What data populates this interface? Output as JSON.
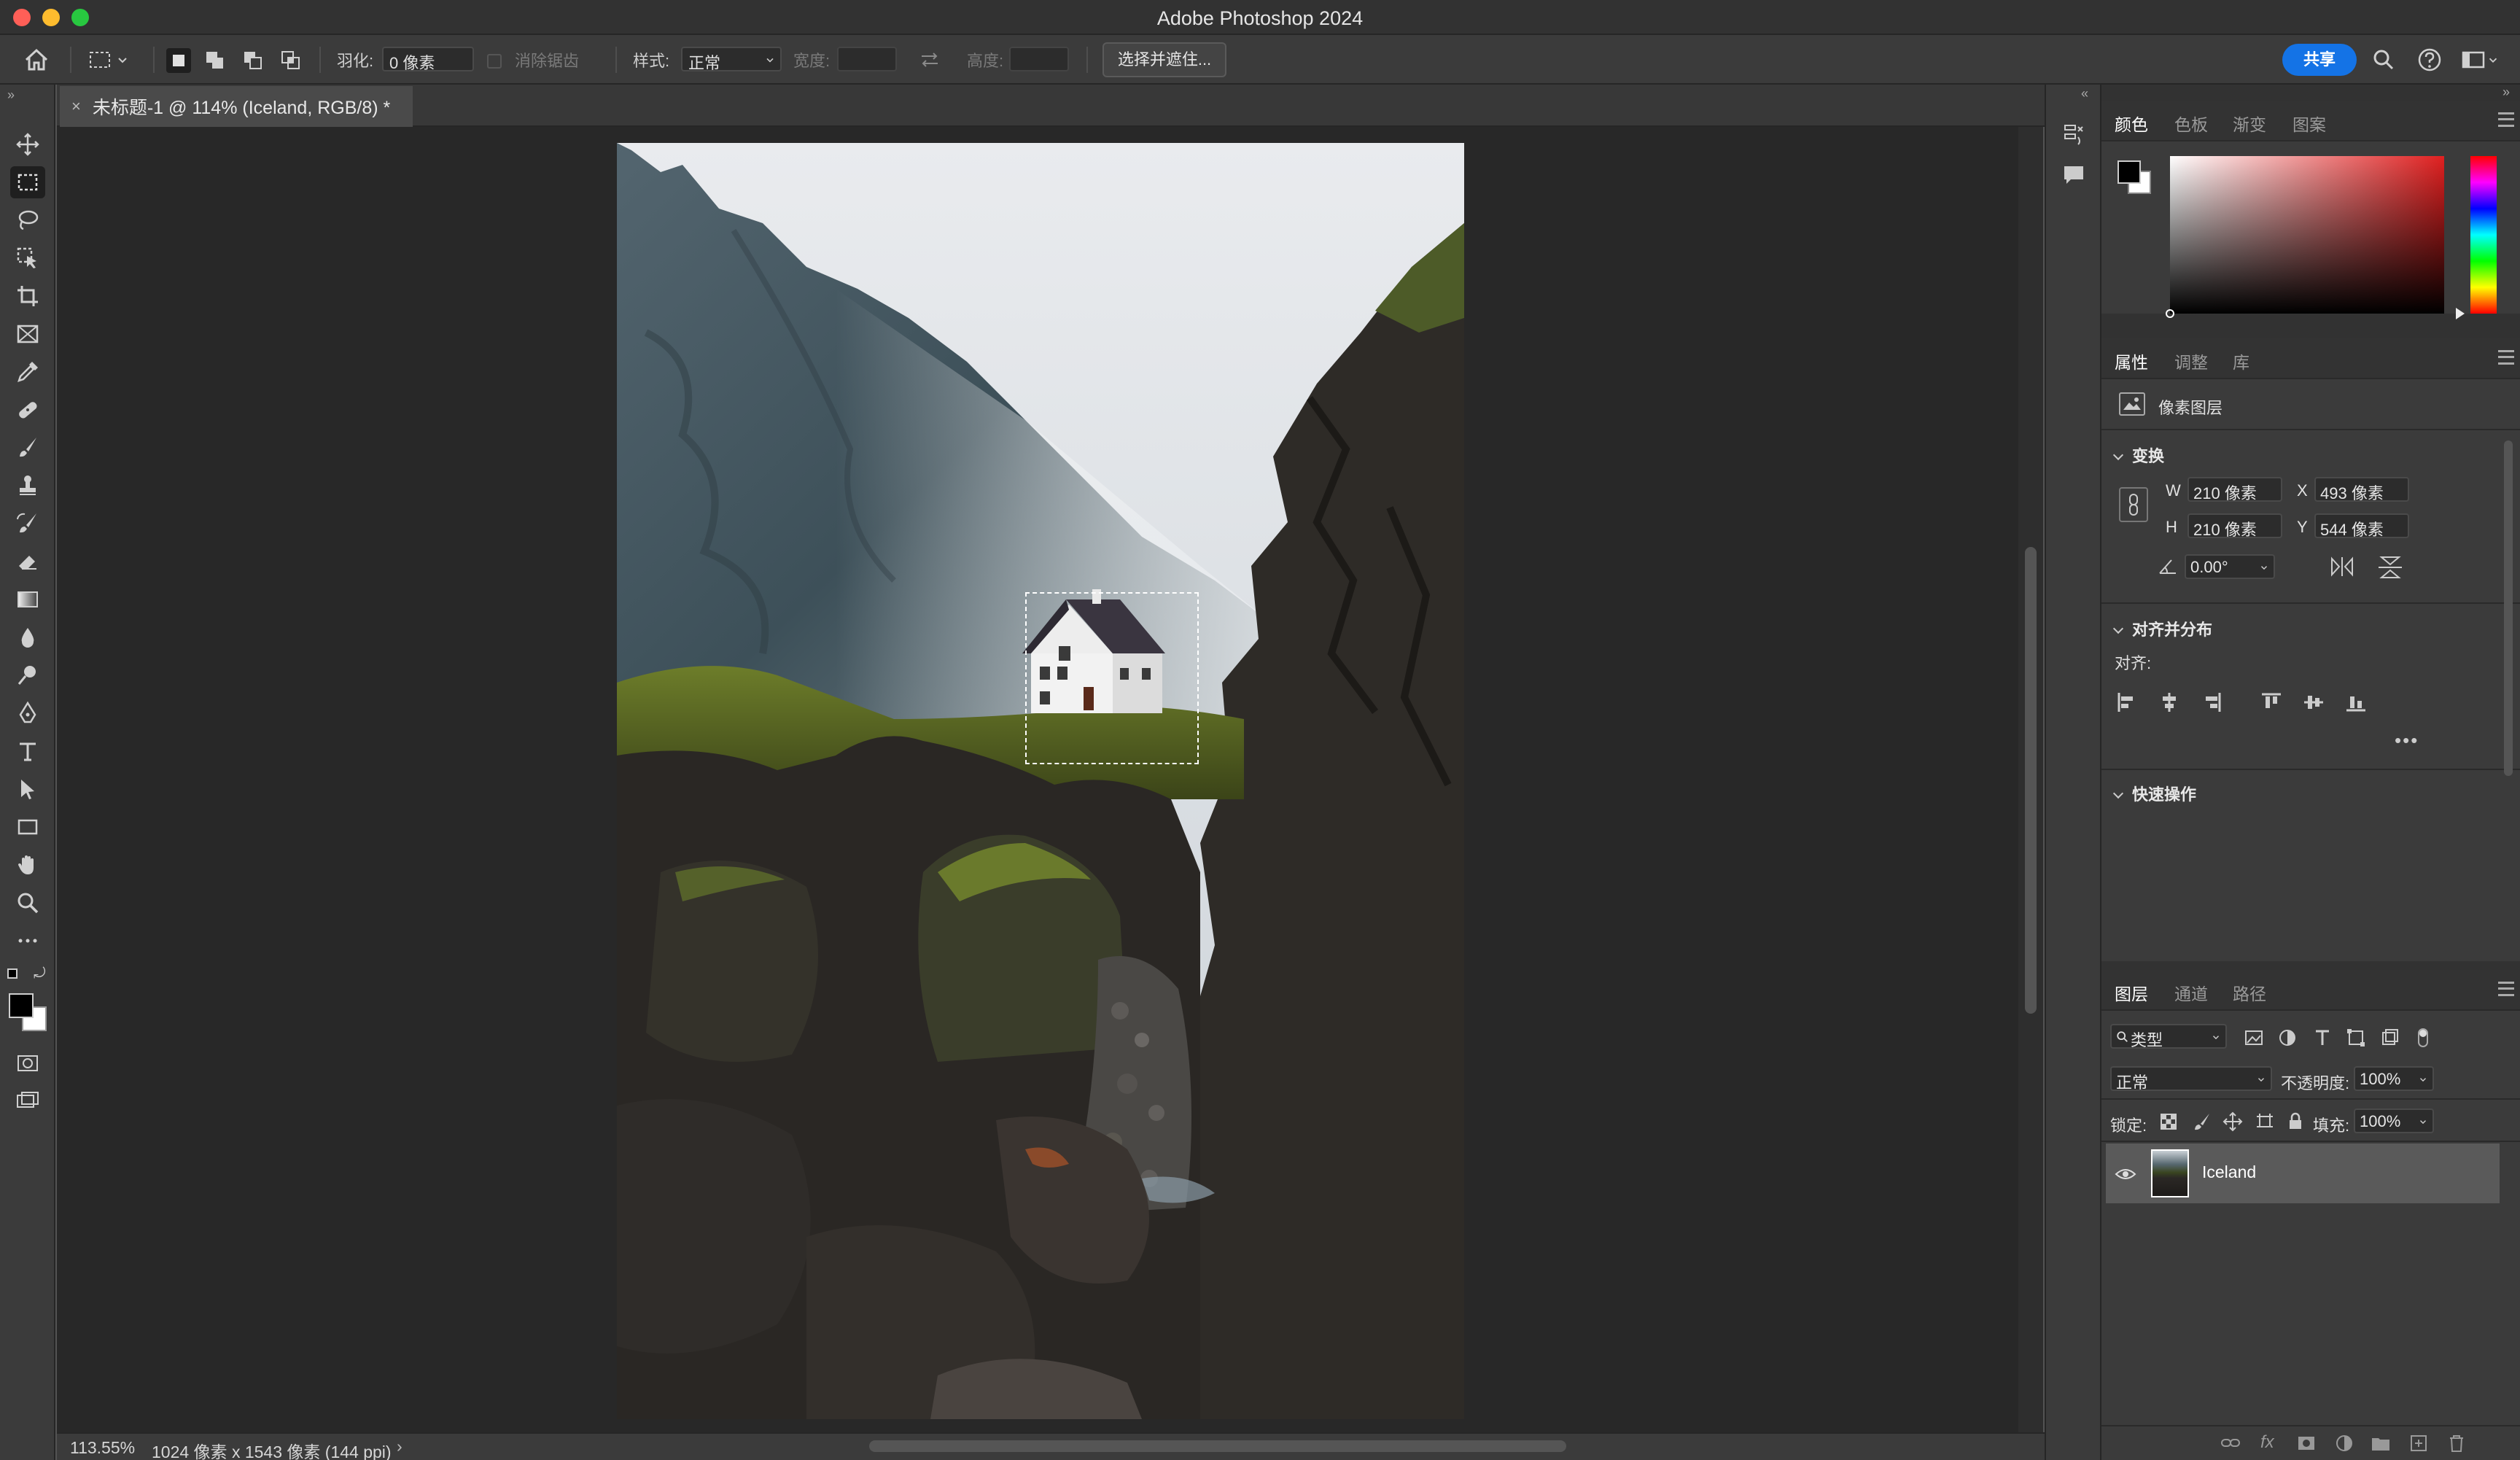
{
  "app": {
    "title": "Adobe Photoshop 2024",
    "traffic_colors": [
      "#ff5f57",
      "#febc2e",
      "#28c840"
    ]
  },
  "options_bar": {
    "feather_label": "羽化:",
    "feather_value": "0 像素",
    "antialias_label": "消除锯齿",
    "style_label": "样式:",
    "style_value": "正常",
    "width_label": "宽度:",
    "height_label": "高度:",
    "select_mask_label": "选择并遮住...",
    "share_label": "共享",
    "accent": "#1473e6"
  },
  "tools": [
    {
      "name": "move-tool",
      "icon": "move-icon"
    },
    {
      "name": "marquee-tool",
      "icon": "rect-marquee-icon",
      "active": true
    },
    {
      "name": "lasso-tool",
      "icon": "lasso-icon"
    },
    {
      "name": "object-select-tool",
      "icon": "object-select-icon"
    },
    {
      "name": "crop-tool",
      "icon": "crop-icon"
    },
    {
      "name": "frame-tool",
      "icon": "frame-icon"
    },
    {
      "name": "eyedropper-tool",
      "icon": "eyedropper-icon"
    },
    {
      "name": "healing-tool",
      "icon": "bandage-icon"
    },
    {
      "name": "brush-tool",
      "icon": "brush-icon"
    },
    {
      "name": "stamp-tool",
      "icon": "stamp-icon"
    },
    {
      "name": "history-brush-tool",
      "icon": "history-brush-icon"
    },
    {
      "name": "eraser-tool",
      "icon": "eraser-icon"
    },
    {
      "name": "gradient-tool",
      "icon": "gradient-icon"
    },
    {
      "name": "blur-tool",
      "icon": "drop-icon"
    },
    {
      "name": "dodge-tool",
      "icon": "dodge-icon"
    },
    {
      "name": "pen-tool",
      "icon": "pen-icon"
    },
    {
      "name": "type-tool",
      "icon": "type-icon"
    },
    {
      "name": "path-select-tool",
      "icon": "arrow-icon"
    },
    {
      "name": "rectangle-tool",
      "icon": "rectangle-icon"
    },
    {
      "name": "hand-tool",
      "icon": "hand-icon"
    },
    {
      "name": "zoom-tool",
      "icon": "zoom-icon"
    },
    {
      "name": "more-tools",
      "icon": "ellipsis-icon"
    }
  ],
  "document": {
    "tab_title": "未标题-1 @ 114% (Iceland, RGB/8) *",
    "zoom": "113.55%",
    "info": "1024 像素 x 1543 像素 (144 ppi)"
  },
  "color_panel": {
    "tabs": [
      "颜色",
      "色板",
      "渐变",
      "图案"
    ],
    "hue_color": "#e02020"
  },
  "properties_panel": {
    "tabs": [
      "属性",
      "调整",
      "库"
    ],
    "layer_type": "像素图层",
    "transform_title": "变换",
    "w_label": "W",
    "w_value": "210 像素",
    "h_label": "H",
    "h_value": "210 像素",
    "x_label": "X",
    "x_value": "493 像素",
    "y_label": "Y",
    "y_value": "544 像素",
    "angle_value": "0.00°",
    "align_title": "对齐并分布",
    "align_label": "对齐:",
    "quick_title": "快速操作"
  },
  "layers_panel": {
    "tabs": [
      "图层",
      "通道",
      "路径"
    ],
    "filter_label": "类型",
    "blend_mode": "正常",
    "opacity_label": "不透明度:",
    "opacity_value": "100%",
    "lock_label": "锁定:",
    "fill_label": "填充:",
    "fill_value": "100%",
    "layer_name": "Iceland"
  }
}
